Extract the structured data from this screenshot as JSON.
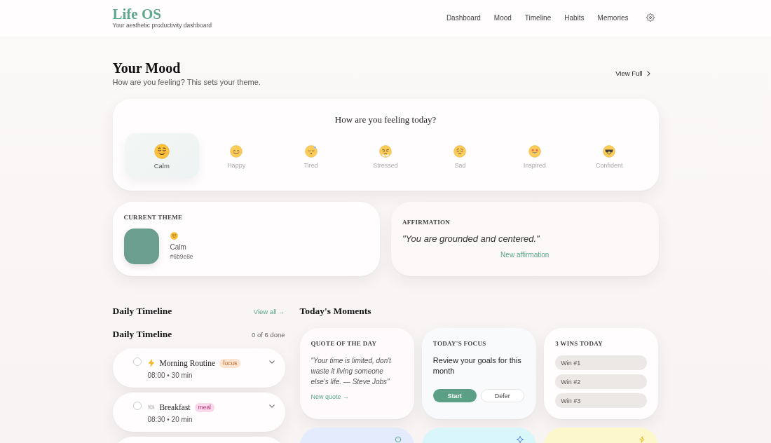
{
  "header": {
    "logo": "Life OS",
    "tagline": "Your aesthetic productivity dashboard",
    "nav": [
      "Dashboard",
      "Mood",
      "Timeline",
      "Habits",
      "Memories"
    ]
  },
  "mood_section": {
    "title": "Your Mood",
    "subtitle": "How are you feeling? This sets your theme.",
    "link": "View Full"
  },
  "mood_card": {
    "question": "How are you feeling today?",
    "moods": [
      {
        "label": "Calm",
        "kind": "relieved",
        "selected": true
      },
      {
        "label": "Happy",
        "kind": "smiling",
        "selected": false
      },
      {
        "label": "Tired",
        "kind": "sleepy",
        "selected": false
      },
      {
        "label": "Stressed",
        "kind": "steaming",
        "selected": false
      },
      {
        "label": "Sad",
        "kind": "pensive",
        "selected": false
      },
      {
        "label": "Inspired",
        "kind": "starstruck",
        "selected": false
      },
      {
        "label": "Confident",
        "kind": "sunglasses",
        "selected": false
      }
    ]
  },
  "theme_card": {
    "heading": "CURRENT THEME",
    "color": "#6b9e8e",
    "kind": "relieved",
    "name": "Calm",
    "hex": "#6b9e8e"
  },
  "affirmation_card": {
    "heading": "AFFIRMATION",
    "quote": "\"You are grounded and centered.\"",
    "link": "New affirmation"
  },
  "timeline": {
    "title": "Daily Timeline",
    "link": "View all →",
    "subtitle": "Daily Timeline",
    "progress": "0 of 6 done",
    "items": [
      {
        "kind": "bolt",
        "title": "Morning Routine",
        "tag": {
          "label": "focus",
          "color": "#fde5d2"
        },
        "meta": "08:00 • 30 min",
        "checked": false,
        "expanded": false
      },
      {
        "kind": "plate",
        "title": "Breakfast",
        "tag": {
          "label": "meal",
          "color": "#fad9ea"
        },
        "meta": "08:30 • 20 min",
        "checked": false,
        "expanded": false
      }
    ]
  },
  "moments": {
    "title": "Today's Moments",
    "quote_card": {
      "heading": "QUOTE OF THE DAY",
      "quote": "\"Your time is limited, don't waste it living someone else's life. — Steve Jobs\"",
      "link": "New quote →"
    },
    "focus_card": {
      "heading": "TODAY'S FOCUS",
      "text": "Review your goals for this month",
      "buttons": [
        {
          "label": "Start",
          "kind": "primary"
        },
        {
          "label": "Defer",
          "kind": "secondary"
        }
      ]
    },
    "wins_card": {
      "heading": "3 WINS TODAY",
      "wins": [
        {
          "placeholder": "Win #1"
        },
        {
          "placeholder": "Win #2"
        },
        {
          "placeholder": "Win #3"
        }
      ]
    },
    "lower_cards": [
      {
        "color": "#e3ebfd",
        "kind": "ring"
      },
      {
        "color": "#d9f7fb",
        "kind": "sparkle"
      },
      {
        "color": "#fdf7cc",
        "kind": "bolt"
      }
    ]
  }
}
